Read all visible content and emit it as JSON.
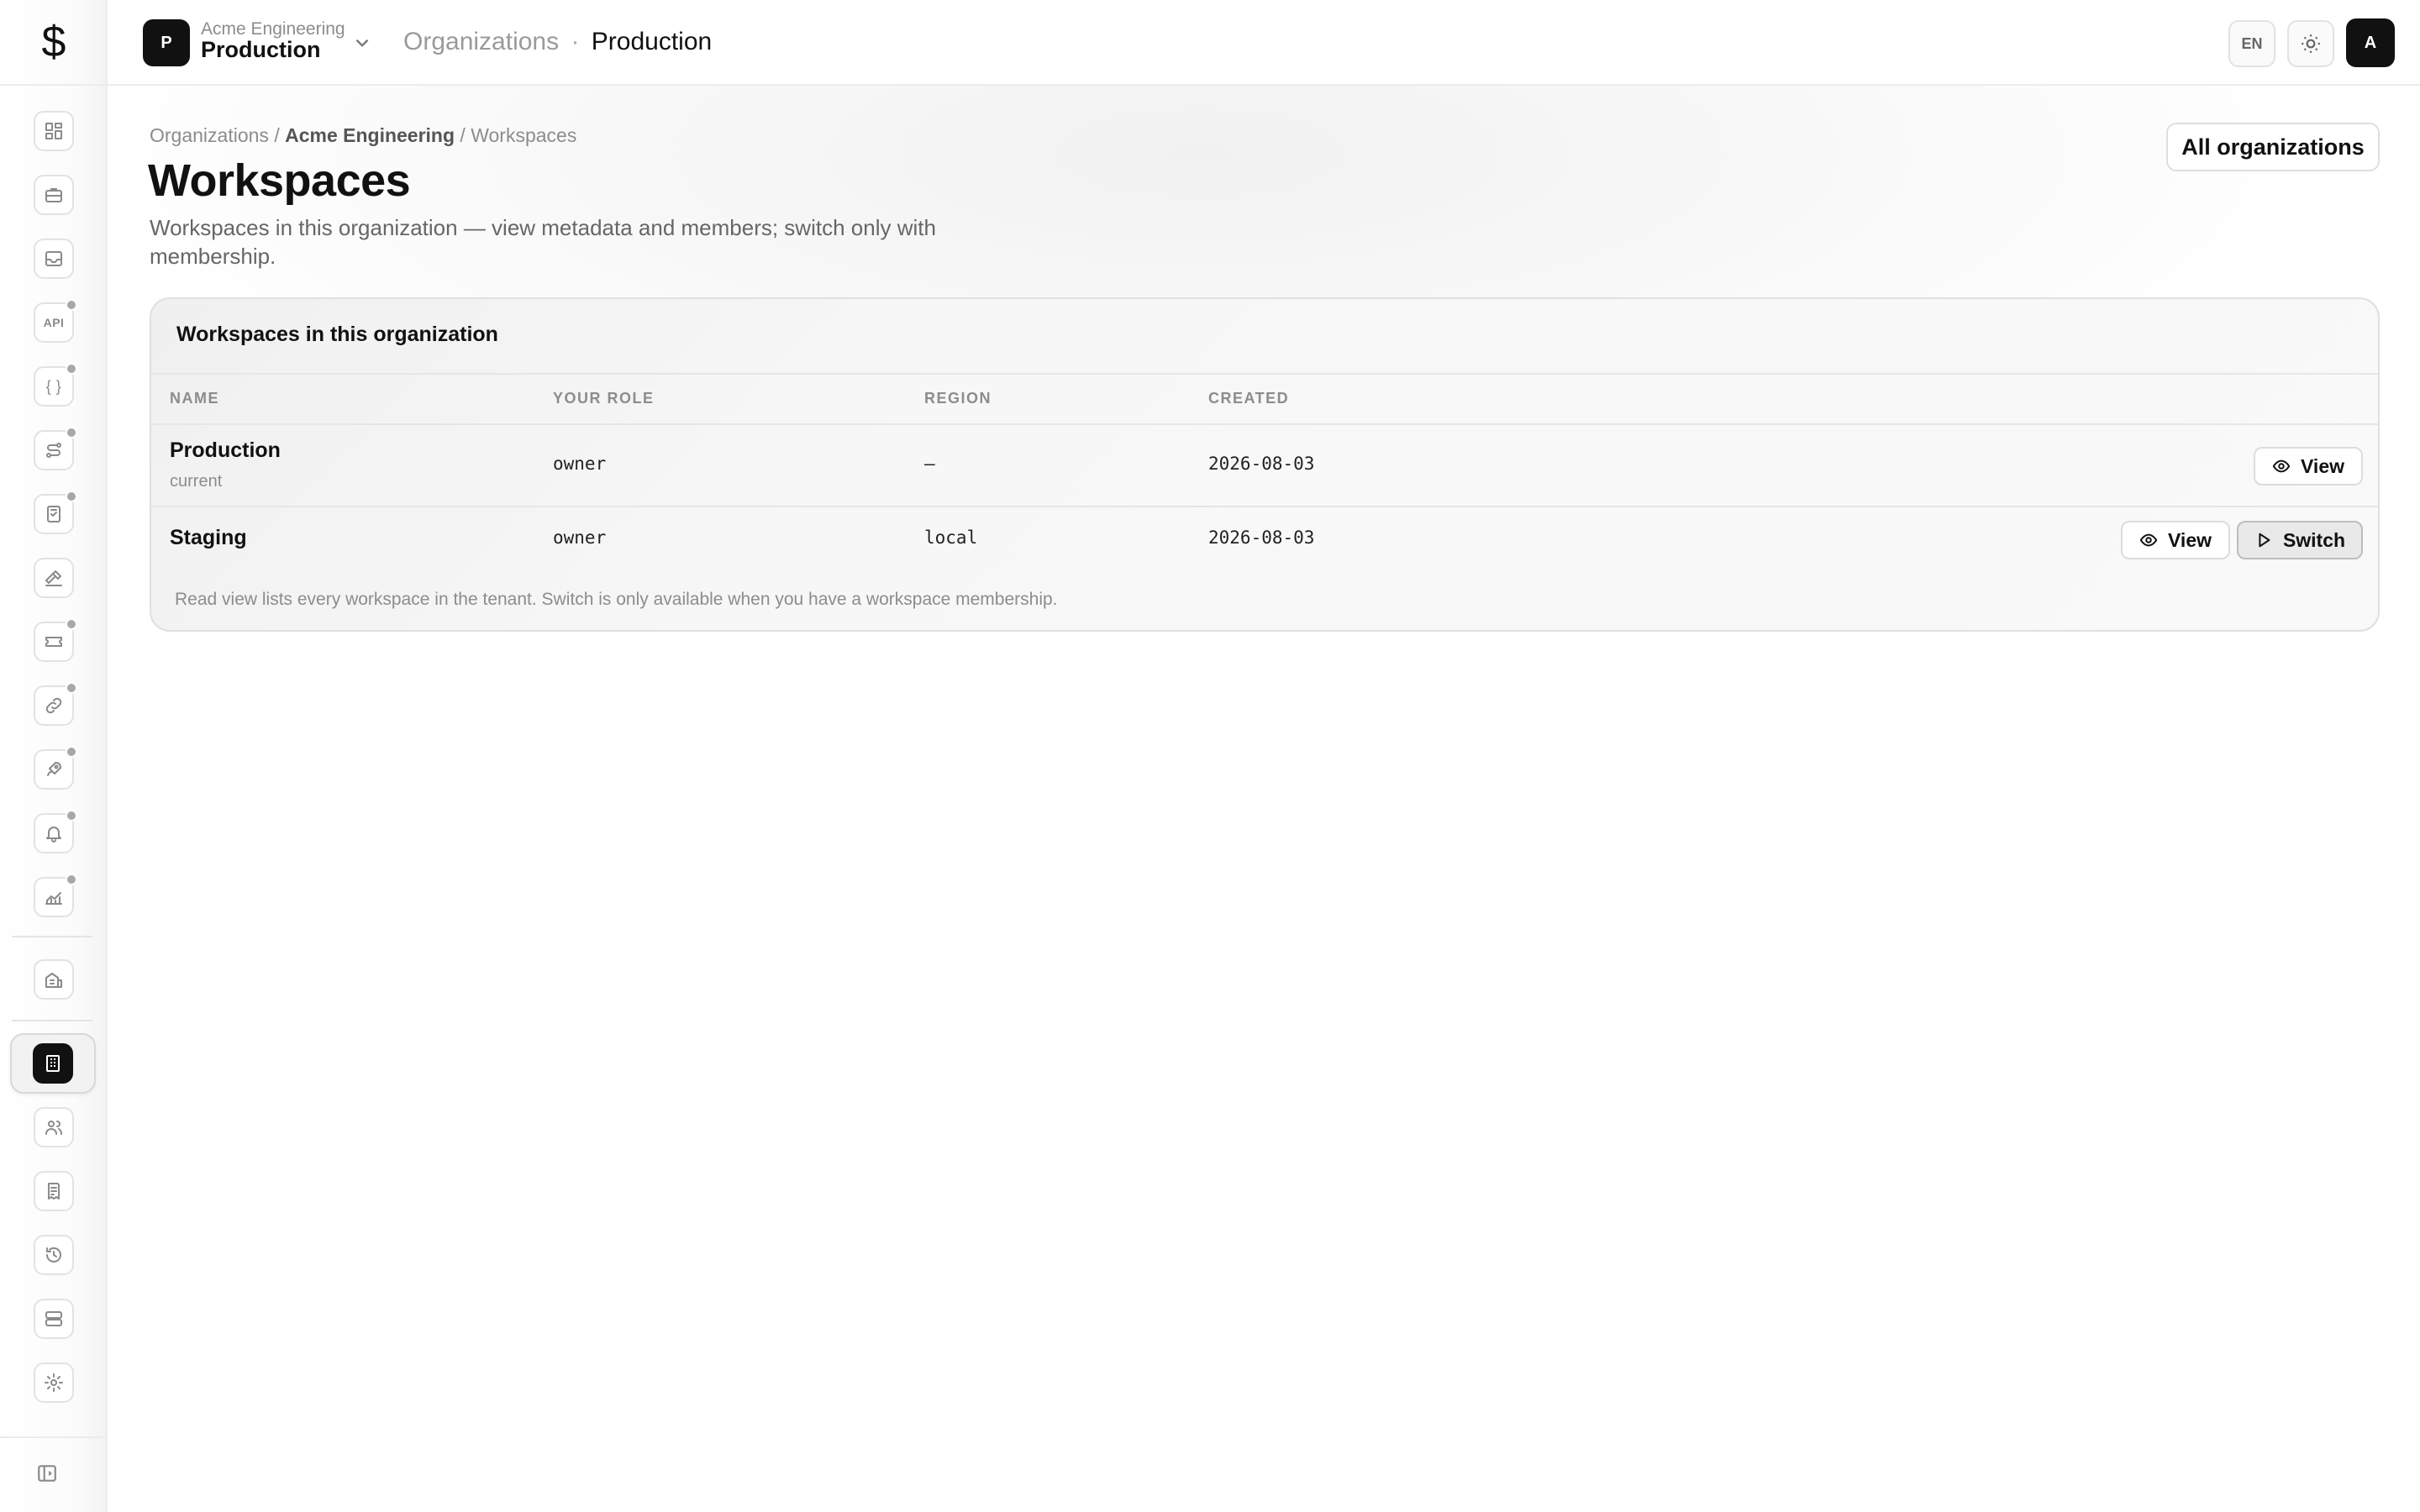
{
  "app": {
    "logo_glyph": "$"
  },
  "topbar": {
    "workspace_badge": "P",
    "org_name": "Acme Engineering",
    "workspace_name": "Production",
    "crumb_parent": "Organizations",
    "crumb_separator": "·",
    "crumb_current": "Production",
    "language": "EN",
    "avatar_initial": "A"
  },
  "sidebar": {
    "api_label": "API",
    "braces_label": "{ }"
  },
  "breadcrumb": {
    "root": "Organizations",
    "sep": "/",
    "org": "Acme Engineering",
    "current": "Workspaces"
  },
  "page": {
    "title": "Workspaces",
    "description": "Workspaces in this organization — view metadata and members; switch only with membership.",
    "all_orgs_button": "All organizations"
  },
  "table": {
    "card_title": "Workspaces in this organization",
    "headers": {
      "name": "NAME",
      "role": "YOUR ROLE",
      "region": "REGION",
      "created": "CREATED"
    },
    "rows": [
      {
        "name": "Production",
        "sub": "current",
        "role": "owner",
        "region": "—",
        "created": "2026-08-03",
        "view_label": "View"
      },
      {
        "name": "Staging",
        "role": "owner",
        "region": "local",
        "created": "2026-08-03",
        "view_label": "View",
        "switch_label": "Switch"
      }
    ],
    "note": "Read view lists every workspace in the tenant. Switch is only available when you have a workspace membership."
  },
  "colors": {
    "accent": "#111111",
    "muted_text": "#8c8c8c",
    "border": "#e0e0e0",
    "badge_dot": "#a8a8a8"
  }
}
